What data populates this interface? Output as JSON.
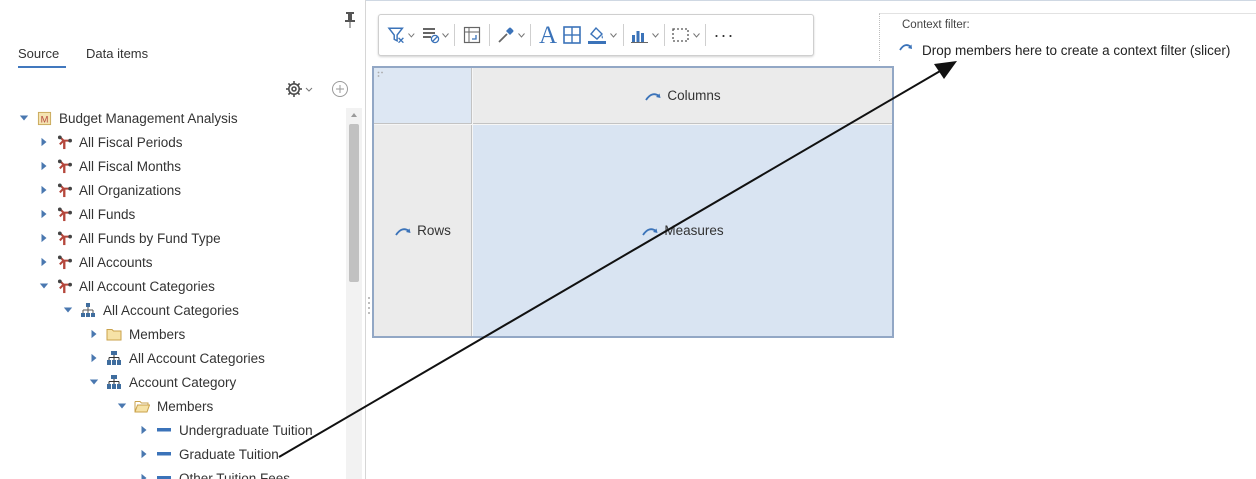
{
  "panel": {
    "tabs": [
      {
        "label": "Source",
        "active": true
      },
      {
        "label": "Data items",
        "active": false
      }
    ],
    "tools": {
      "gear_icon": "gear-icon",
      "add_icon": "plus-circle-icon"
    }
  },
  "tree": {
    "items": [
      {
        "label": "Budget Management Analysis",
        "icon": "cube-icon",
        "toggle": "expanded"
      },
      {
        "label": "All Fiscal Periods",
        "icon": "dimension-icon",
        "toggle": "collapsed"
      },
      {
        "label": "All Fiscal Months",
        "icon": "dimension-icon",
        "toggle": "collapsed"
      },
      {
        "label": "All Organizations",
        "icon": "dimension-icon",
        "toggle": "collapsed"
      },
      {
        "label": "All Funds",
        "icon": "dimension-icon",
        "toggle": "collapsed"
      },
      {
        "label": "All Funds by Fund Type",
        "icon": "dimension-icon",
        "toggle": "collapsed"
      },
      {
        "label": "All Accounts",
        "icon": "dimension-icon",
        "toggle": "collapsed"
      },
      {
        "label": "All Account Categories",
        "icon": "dimension-icon",
        "toggle": "expanded"
      },
      {
        "label": "All Account Categories",
        "icon": "hierarchy-icon",
        "toggle": "expanded"
      },
      {
        "label": "Members",
        "icon": "folder-icon",
        "toggle": "collapsed"
      },
      {
        "label": "All Account Categories",
        "icon": "level-icon",
        "toggle": "collapsed"
      },
      {
        "label": "Account Category",
        "icon": "level-icon",
        "toggle": "expanded"
      },
      {
        "label": "Members",
        "icon": "folder-open-icon",
        "toggle": "expanded"
      },
      {
        "label": "Undergraduate Tuition",
        "icon": "member-icon",
        "toggle": "collapsed"
      },
      {
        "label": "Graduate Tuition",
        "icon": "member-icon",
        "toggle": "collapsed"
      },
      {
        "label": "Other Tuition Fees",
        "icon": "member-icon",
        "toggle": "collapsed"
      }
    ]
  },
  "toolbar": {
    "buttons": [
      "filter-icon",
      "suppress-icon",
      "swap-icon",
      "color-picker-icon",
      "text-font-icon",
      "borders-icon",
      "fill-color-icon",
      "chart-icon",
      "select-icon",
      "more-icon"
    ],
    "font_glyph": "A",
    "more_glyph": "···"
  },
  "context_filter": {
    "title": "Context filter:",
    "drop_text": "Drop members here to create a context filter (slicer)"
  },
  "crosstab": {
    "columns_label": "Columns",
    "rows_label": "Rows",
    "measures_label": "Measures"
  },
  "colors": {
    "accent": "#4178be",
    "crosstab_border": "#92a7c5",
    "measures_fill": "#d9e4f2",
    "corner_fill": "#dde7f3",
    "dimension_icon": "#b5473c",
    "level_icon": "#3f6d9e",
    "member_icon": "#3b73b9"
  }
}
